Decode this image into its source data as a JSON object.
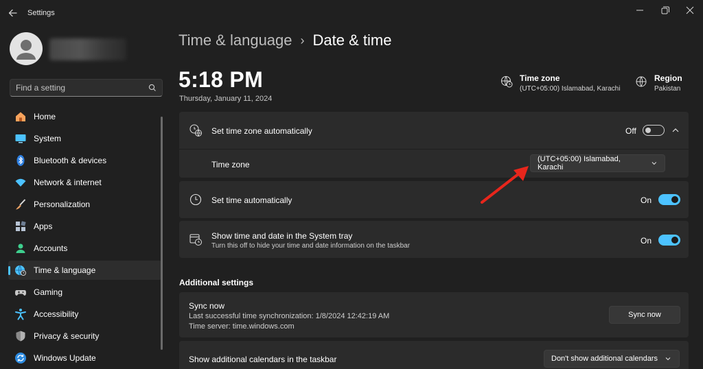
{
  "window": {
    "app_title": "Settings"
  },
  "search": {
    "placeholder": "Find a setting"
  },
  "sidebar": {
    "items": [
      {
        "label": "Home",
        "icon": "home-icon",
        "color": "#f7a35c"
      },
      {
        "label": "System",
        "icon": "monitor-icon",
        "color": "#4cc2ff"
      },
      {
        "label": "Bluetooth & devices",
        "icon": "bluetooth-icon",
        "color": "#2d7fe0"
      },
      {
        "label": "Network & internet",
        "icon": "wifi-icon",
        "color": "#4cc2ff"
      },
      {
        "label": "Personalization",
        "icon": "brush-icon",
        "color": "#e8a063"
      },
      {
        "label": "Apps",
        "icon": "apps-icon",
        "color": "#b8c4d4"
      },
      {
        "label": "Accounts",
        "icon": "person-icon",
        "color": "#3ecf8e"
      },
      {
        "label": "Time & language",
        "icon": "globe-clock-icon",
        "color": "#4cc2ff",
        "active": true
      },
      {
        "label": "Gaming",
        "icon": "controller-icon",
        "color": "#c8c8c8"
      },
      {
        "label": "Accessibility",
        "icon": "accessibility-icon",
        "color": "#4cc2ff"
      },
      {
        "label": "Privacy & security",
        "icon": "shield-icon",
        "color": "#8a8a8a"
      },
      {
        "label": "Windows Update",
        "icon": "update-icon",
        "color": "#2d8be0"
      }
    ]
  },
  "header": {
    "breadcrumb_parent": "Time & language",
    "breadcrumb_separator": "›",
    "breadcrumb_current": "Date & time"
  },
  "clock": {
    "time": "5:18 PM",
    "date": "Thursday, January 11, 2024"
  },
  "info": {
    "timezone_title": "Time zone",
    "timezone_value": "(UTC+05:00) Islamabad, Karachi",
    "region_title": "Region",
    "region_value": "Pakistan"
  },
  "settings": {
    "auto_timezone": {
      "title": "Set time zone automatically",
      "state_label": "Off",
      "on": false
    },
    "timezone": {
      "title": "Time zone",
      "value": "(UTC+05:00) Islamabad, Karachi"
    },
    "auto_time": {
      "title": "Set time automatically",
      "state_label": "On",
      "on": true
    },
    "tray": {
      "title": "Show time and date in the System tray",
      "subtitle": "Turn this off to hide your time and date information on the taskbar",
      "state_label": "On",
      "on": true
    }
  },
  "additional": {
    "section_title": "Additional settings",
    "sync": {
      "title": "Sync now",
      "last_sync": "Last successful time synchronization: 1/8/2024 12:42:19 AM",
      "server": "Time server: time.windows.com",
      "button_label": "Sync now"
    },
    "calendars": {
      "title": "Show additional calendars in the taskbar",
      "value": "Don't show additional calendars"
    }
  },
  "colors": {
    "accent": "#4cc2ff",
    "annotation_arrow": "#e8261c"
  }
}
